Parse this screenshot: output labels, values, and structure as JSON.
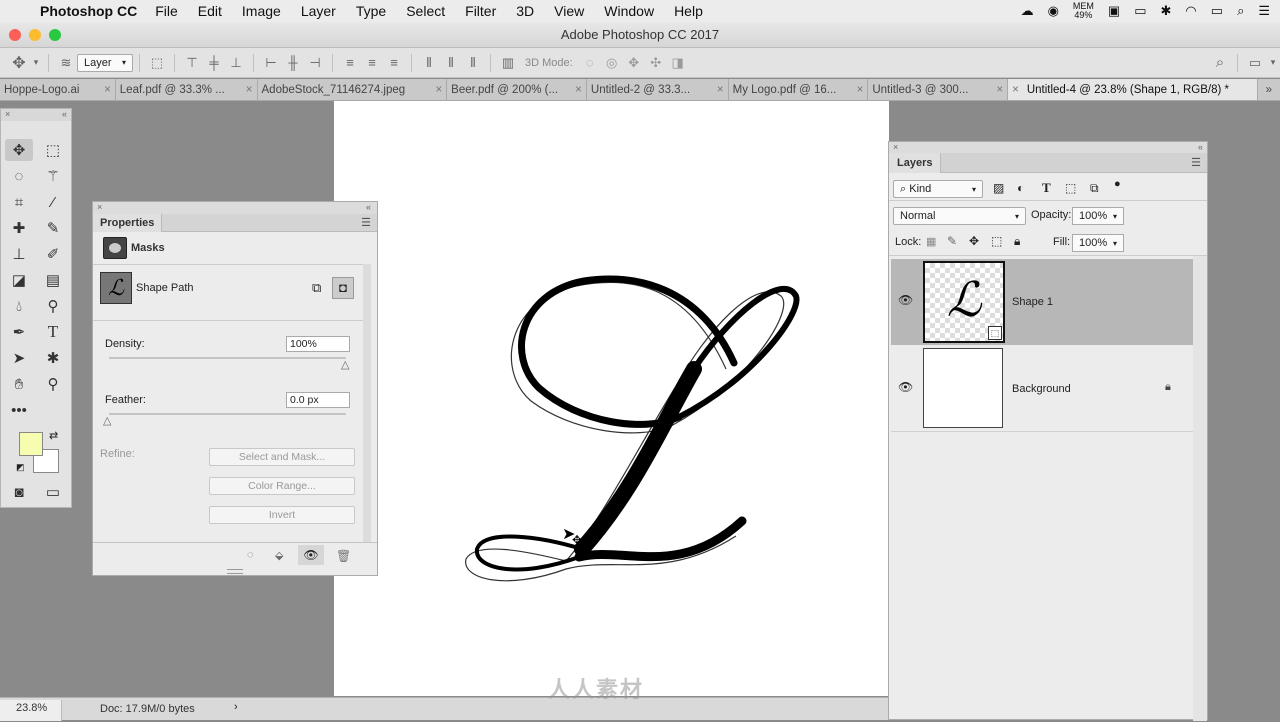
{
  "menubar": {
    "app_name": "Photoshop CC",
    "items": [
      "File",
      "Edit",
      "Image",
      "Layer",
      "Type",
      "Select",
      "Filter",
      "3D",
      "View",
      "Window",
      "Help"
    ],
    "mem_label": "MEM",
    "mem_value": "49%"
  },
  "window": {
    "title": "Adobe Photoshop CC 2017"
  },
  "optionsbar": {
    "auto_select_value": "Layer",
    "mode_3d_label": "3D Mode:"
  },
  "tabs": [
    {
      "label": "Hoppe-Logo.ai"
    },
    {
      "label": "Leaf.pdf @ 33.3% ..."
    },
    {
      "label": "AdobeStock_71146274.jpeg"
    },
    {
      "label": "Beer.pdf @ 200% (..."
    },
    {
      "label": "Untitled-2 @ 33.3..."
    },
    {
      "label": "My Logo.pdf @ 16..."
    },
    {
      "label": "Untitled-3 @ 300..."
    },
    {
      "label": "Untitled-4 @ 23.8% (Shape 1, RGB/8) *"
    }
  ],
  "tab_close_glyph": "×",
  "properties": {
    "tab_label": "Properties",
    "section_label": "Masks",
    "shape_path_label": "Shape Path",
    "density_label": "Density:",
    "density_value": "100%",
    "feather_label": "Feather:",
    "feather_value": "0.0 px",
    "refine_label": "Refine:",
    "select_and_mask_label": "Select and Mask...",
    "color_range_label": "Color Range...",
    "invert_label": "Invert"
  },
  "layers": {
    "tab_label": "Layers",
    "filter_kind": "Kind",
    "blend_mode": "Normal",
    "opacity_label": "Opacity:",
    "opacity_value": "100%",
    "lock_label": "Lock:",
    "fill_label": "Fill:",
    "fill_value": "100%",
    "items": [
      {
        "name": "Shape 1",
        "selected": true
      },
      {
        "name": "Background",
        "locked": true
      }
    ]
  },
  "status": {
    "zoom": "23.8%",
    "doc_info": "Doc: 17.9M/0 bytes"
  },
  "colors": {
    "foreground": "#f6fdb0",
    "background": "#ffffff",
    "selected_layer": "#b7b7b7"
  },
  "watermark": {
    "logo_text": "人人素材"
  }
}
